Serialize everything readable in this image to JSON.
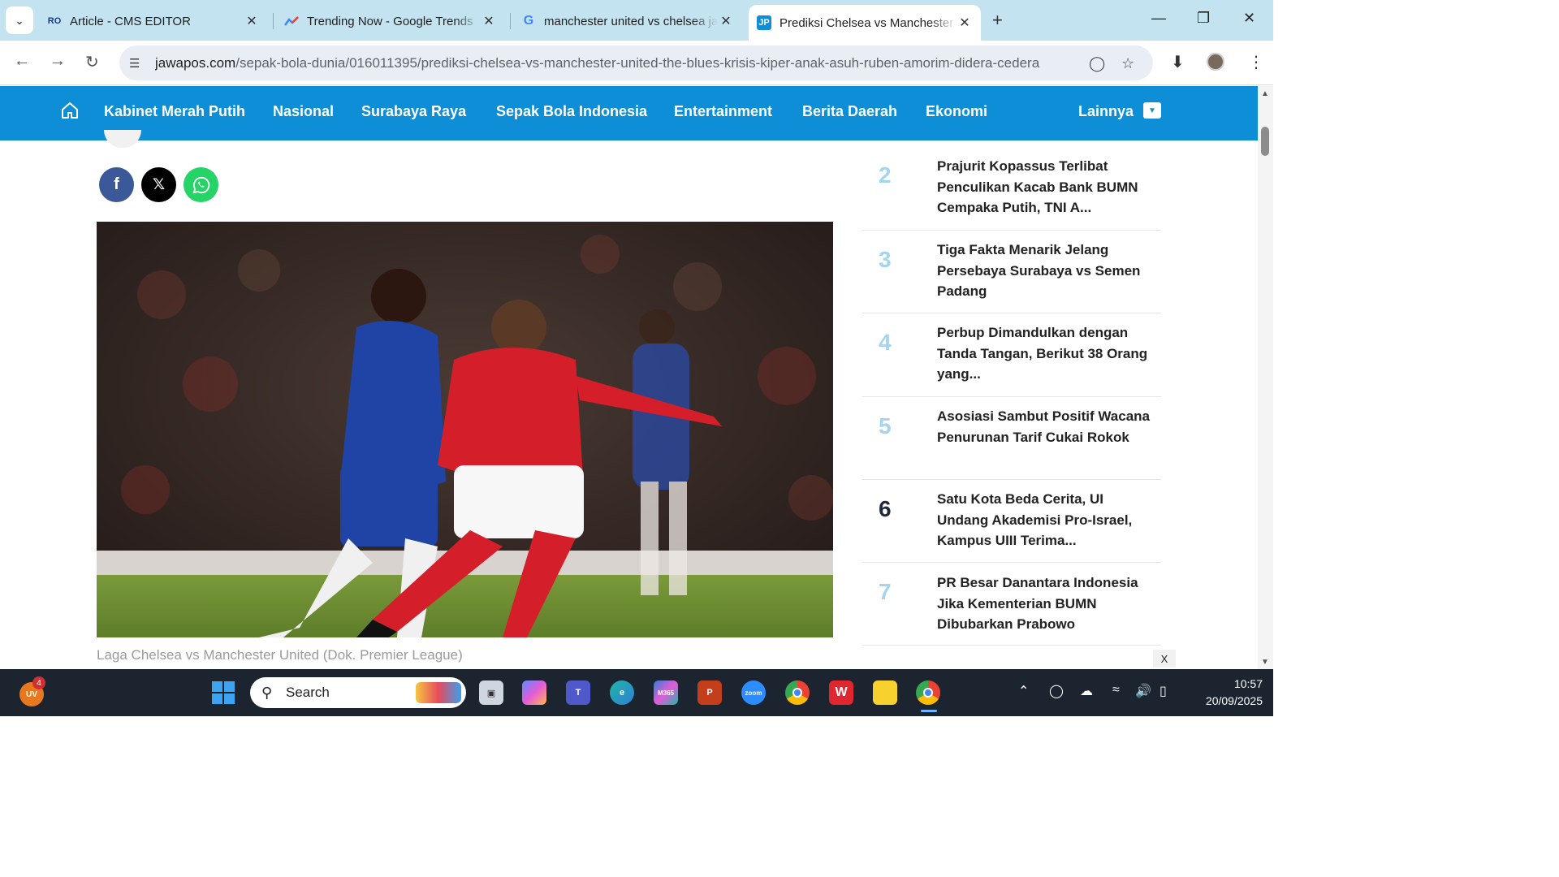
{
  "browser": {
    "tabs": [
      {
        "title": "Article - CMS EDITOR",
        "favicon": "RO"
      },
      {
        "title": "Trending Now - Google Trends",
        "favicon": "trends-icon"
      },
      {
        "title": "manchester united vs chelsea ja",
        "favicon": "G"
      },
      {
        "title": "Prediksi Chelsea vs Manchester",
        "favicon": "JP",
        "active": true
      }
    ],
    "url_domain": "jawapos.com",
    "url_path": "/sepak-bola-dunia/016011395/prediksi-chelsea-vs-manchester-united-the-blues-krisis-kiper-anak-asuh-ruben-amorim-didera-cedera"
  },
  "sitenav": {
    "items": [
      "Kabinet Merah Putih",
      "Nasional",
      "Surabaya Raya",
      "Sepak Bola Indonesia",
      "Entertainment",
      "Berita Daerah",
      "Ekonomi"
    ],
    "more": "Lainnya",
    "color": "#0e8ed6"
  },
  "article": {
    "caption": "Laga Chelsea vs Manchester United (Dok. Premier League)",
    "share": {
      "facebook_color": "#3b5998",
      "x_color": "#000000",
      "whatsapp_color": "#25d366"
    }
  },
  "popular": [
    {
      "num": "2",
      "title": "Prajurit Kopassus Terlibat Penculikan Kacab Bank BUMN Cempaka Putih, TNI A..."
    },
    {
      "num": "3",
      "title": "Tiga Fakta Menarik Jelang Persebaya Surabaya vs Semen Padang"
    },
    {
      "num": "4",
      "title": "Perbup Dimandulkan dengan Tanda Tangan, Berikut 38 Orang yang..."
    },
    {
      "num": "5",
      "title": "Asosiasi Sambut Positif Wacana Penurunan Tarif Cukai Rokok"
    },
    {
      "num": "6",
      "title": "Satu Kota Beda Cerita, UI Undang Akademisi Pro-Israel, Kampus UIII Terima..."
    },
    {
      "num": "7",
      "title": "PR Besar Danantara Indonesia Jika Kementerian BUMN Dibubarkan Prabowo"
    }
  ],
  "ad_close": "X",
  "taskbar": {
    "search_label": "Search",
    "weather_badge": "4",
    "weather_label": "UV",
    "time": "10:57",
    "date": "20/09/2025"
  }
}
